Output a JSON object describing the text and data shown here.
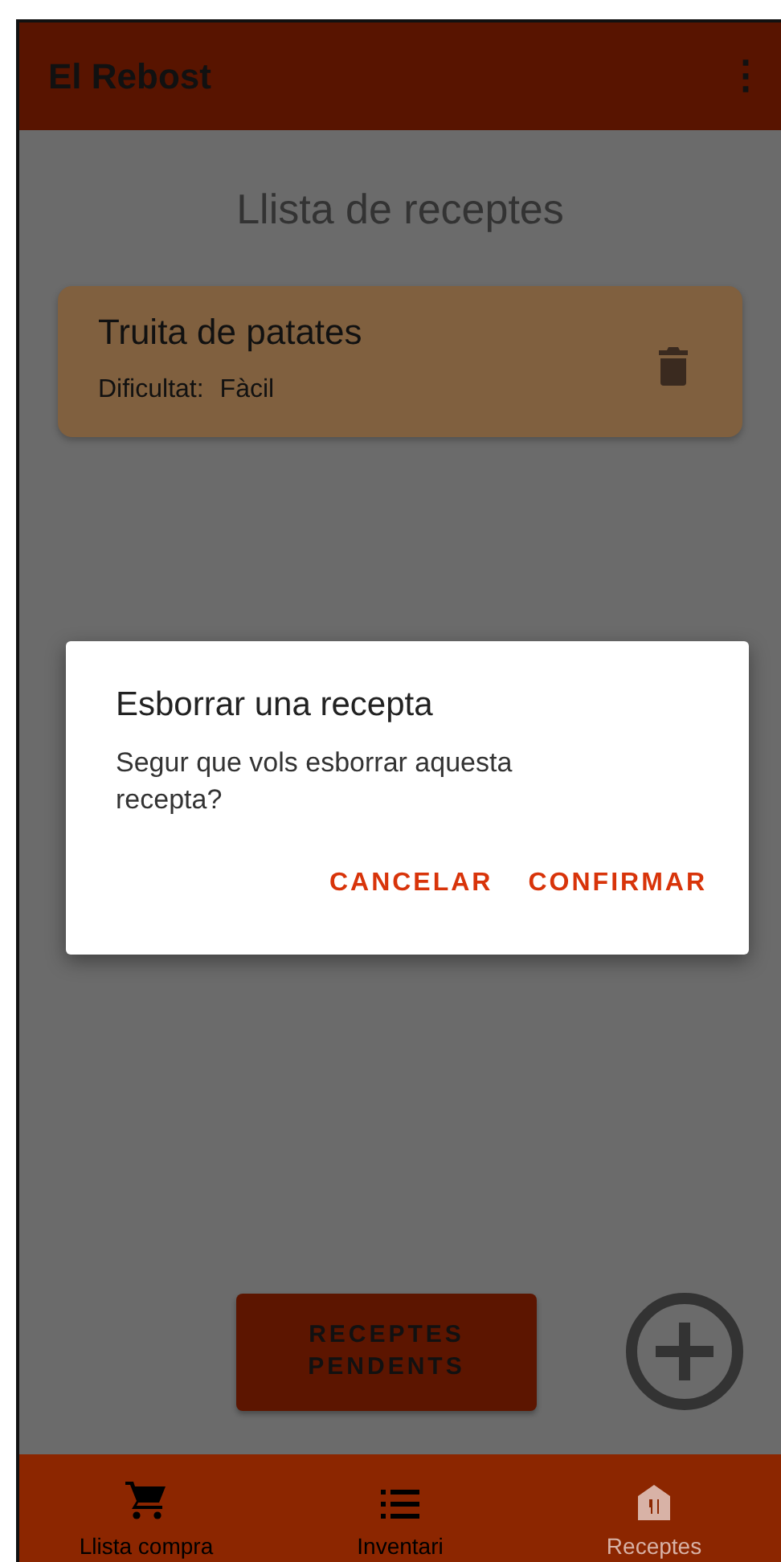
{
  "app_bar": {
    "title": "El Rebost",
    "menu": "⋮"
  },
  "page_title": "Llista de receptes",
  "recipes": [
    {
      "name": "Truita de patates",
      "difficulty_label": "Dificultat:",
      "difficulty": "Fàcil"
    }
  ],
  "pending_button": {
    "label": "RECEPTES PENDENTS"
  },
  "dialog": {
    "title": "Esborrar una recepta",
    "message": "Segur que vols esborrar aquesta recepta?",
    "buttons": [
      "CANCELAR",
      "CONFIRMAR"
    ]
  },
  "bottom_nav": [
    {
      "label": "Llista compra",
      "kind": "cart",
      "selected": false
    },
    {
      "label": "Inventari",
      "kind": "list",
      "selected": false
    },
    {
      "label": "Receptes",
      "kind": "recipes",
      "selected": true
    }
  ]
}
